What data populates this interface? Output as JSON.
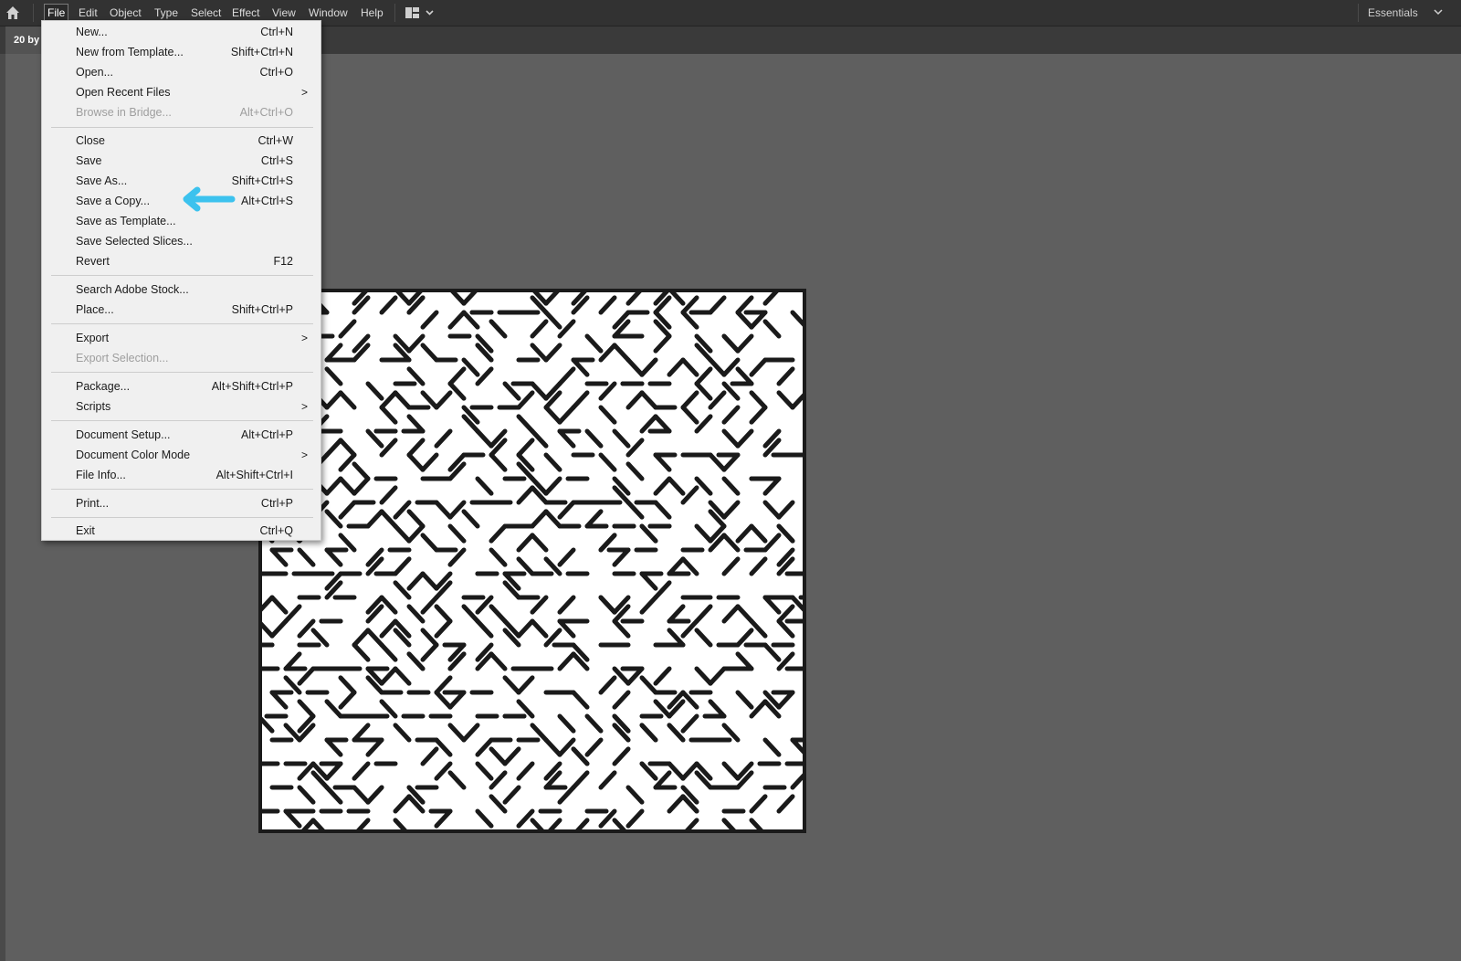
{
  "menubar": {
    "items": [
      "File",
      "Edit",
      "Object",
      "Type",
      "Select",
      "Effect",
      "View",
      "Window",
      "Help"
    ],
    "active": "File",
    "workspace": "Essentials",
    "home_icon": "home-icon",
    "layout_icon": "arrange-documents-icon"
  },
  "tab": {
    "title": "20 by"
  },
  "file_menu": {
    "new": {
      "label": "New...",
      "shortcut": "Ctrl+N"
    },
    "new_template": {
      "label": "New from Template...",
      "shortcut": "Shift+Ctrl+N"
    },
    "open": {
      "label": "Open...",
      "shortcut": "Ctrl+O"
    },
    "open_recent": {
      "label": "Open Recent Files",
      "submenu": true
    },
    "browse_bridge": {
      "label": "Browse in Bridge...",
      "shortcut": "Alt+Ctrl+O",
      "disabled": true
    },
    "close": {
      "label": "Close",
      "shortcut": "Ctrl+W"
    },
    "save": {
      "label": "Save",
      "shortcut": "Ctrl+S"
    },
    "save_as": {
      "label": "Save As...",
      "shortcut": "Shift+Ctrl+S"
    },
    "save_copy": {
      "label": "Save a Copy...",
      "shortcut": "Alt+Ctrl+S"
    },
    "save_template": {
      "label": "Save as Template..."
    },
    "save_slices": {
      "label": "Save Selected Slices..."
    },
    "revert": {
      "label": "Revert",
      "shortcut": "F12"
    },
    "search_stock": {
      "label": "Search Adobe Stock..."
    },
    "place": {
      "label": "Place...",
      "shortcut": "Shift+Ctrl+P"
    },
    "export": {
      "label": "Export",
      "submenu": true
    },
    "export_selection": {
      "label": "Export Selection...",
      "disabled": true
    },
    "package": {
      "label": "Package...",
      "shortcut": "Alt+Shift+Ctrl+P"
    },
    "scripts": {
      "label": "Scripts",
      "submenu": true
    },
    "doc_setup": {
      "label": "Document Setup...",
      "shortcut": "Alt+Ctrl+P"
    },
    "color_mode": {
      "label": "Document Color Mode",
      "submenu": true
    },
    "file_info": {
      "label": "File Info...",
      "shortcut": "Alt+Shift+Ctrl+I"
    },
    "print": {
      "label": "Print...",
      "shortcut": "Ctrl+P"
    },
    "exit": {
      "label": "Exit",
      "shortcut": "Ctrl+Q"
    },
    "submenu_arrow": ">"
  },
  "colors": {
    "annotation_arrow": "#3cc2ee",
    "maze_stroke": "#1a1a1a",
    "canvas_bg": "#5f5f5f"
  }
}
